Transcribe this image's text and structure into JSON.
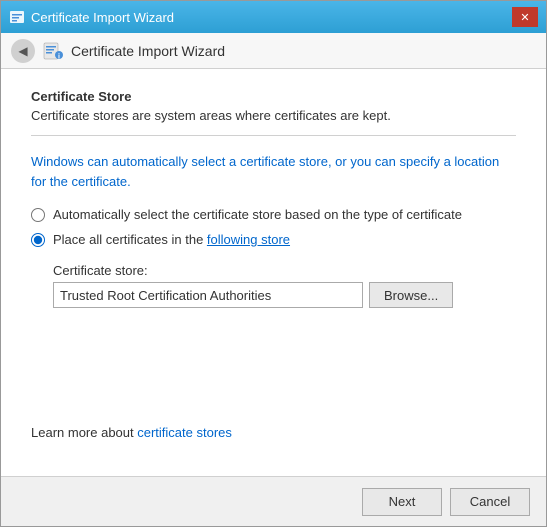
{
  "window": {
    "title": "Certificate Import Wizard"
  },
  "nav": {
    "title": "Certificate Import Wizard"
  },
  "content": {
    "section_title": "Certificate Store",
    "section_subtitle": "Certificate stores are system areas where certificates are kept.",
    "info_text_part1": "Windows can automatically select a certificate store, or you can specify a location for the certificate.",
    "radio_auto_label": "Automatically select the certificate store based on the type of certificate",
    "radio_manual_label_prefix": "Place all certificates in the ",
    "radio_manual_label_link": "following store",
    "cert_store_label": "Certificate store:",
    "cert_store_value": "Trusted Root Certification Authorities",
    "browse_label": "Browse...",
    "footer_text_prefix": "Learn more about ",
    "footer_link_text": "certificate stores"
  },
  "buttons": {
    "next": "Next",
    "cancel": "Cancel"
  },
  "icons": {
    "back": "◀",
    "close": "✕",
    "wizard": "🔒"
  }
}
